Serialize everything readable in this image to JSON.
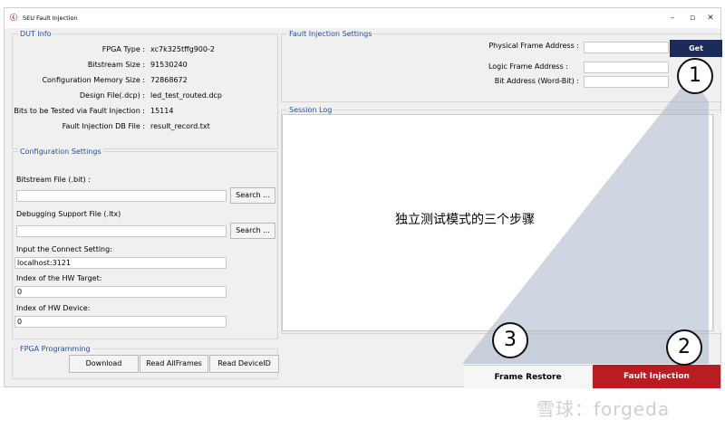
{
  "app": {
    "title": "SEU Fault Injection",
    "logo": "SEU"
  },
  "window_controls": [
    "–",
    "▫",
    "✕"
  ],
  "dut_info": {
    "legend": "DUT Info",
    "rows": [
      {
        "label": "FPGA Type :",
        "value": "xc7k325tffg900-2"
      },
      {
        "label": "Bitstream Size :",
        "value": "91530240"
      },
      {
        "label": "Configuration Memory Size :",
        "value": "72868672"
      },
      {
        "label": "Design File(.dcp) :",
        "value": "led_test_routed.dcp"
      },
      {
        "label": "Bits to be Tested via Fault Injection :",
        "value": "15114"
      },
      {
        "label": "Fault Injection DB File :",
        "value": "result_record.txt"
      }
    ]
  },
  "config": {
    "legend": "Configuration Settings",
    "bitstream_label": "Bitstream File (.bit) :",
    "bitstream_value": "",
    "search_label": "Search ...",
    "debug_label": "Debugging Support File (.ltx)",
    "debug_value": "",
    "connect_label": "Input the Connect Setting:",
    "connect_value": "localhost:3121",
    "hw_target_label": "Index of the HW Target:",
    "hw_target_value": "0",
    "hw_device_label": "Index of HW Device:",
    "hw_device_value": "0"
  },
  "programming": {
    "legend": "FPGA Programming",
    "download": "Download",
    "read_all": "Read AllFrames",
    "read_id": "Read DeviceID"
  },
  "fi_settings": {
    "legend": "Fault Injection Settings",
    "phys_label": "Physical Frame Address :",
    "logic_label": "Logic Frame Address :",
    "bit_label": "Bit Address (Word-Bit) :",
    "get_label": "Get"
  },
  "session_log": {
    "legend": "Session Log"
  },
  "actions": {
    "frame_restore": "Frame Restore",
    "fault_injection": "Fault Injection"
  },
  "annotations": {
    "caption": "独立测试模式的三个步骤",
    "steps": [
      "1",
      "2",
      "3"
    ]
  },
  "watermark": "雪球：forgeda",
  "colors": {
    "accent": "#1c2b59",
    "danger": "#b81d24",
    "legend": "#1f4fa0"
  }
}
